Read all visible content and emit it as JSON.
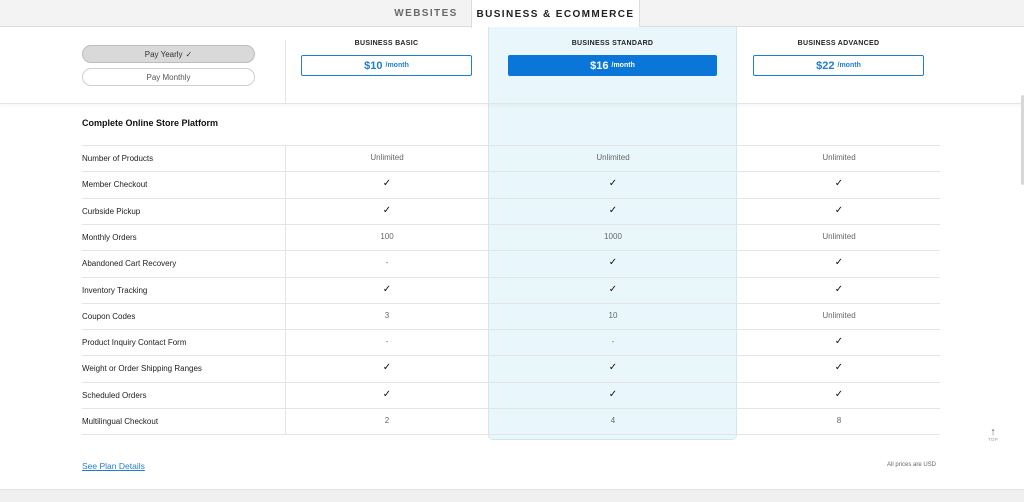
{
  "tabs": [
    {
      "label": "WEBSITES",
      "active": false
    },
    {
      "label": "BUSINESS & ECOMMERCE",
      "active": true
    }
  ],
  "billing": {
    "yearly_label": "Pay Yearly",
    "yearly_check": "✓",
    "monthly_label": "Pay Monthly",
    "selected": "yearly"
  },
  "plans": [
    {
      "name": "BUSINESS BASIC",
      "price": "$10",
      "period": "/month",
      "highlighted": false
    },
    {
      "name": "BUSINESS STANDARD",
      "price": "$16",
      "period": "/month",
      "highlighted": true
    },
    {
      "name": "BUSINESS ADVANCED",
      "price": "$22",
      "period": "/month",
      "highlighted": false
    }
  ],
  "section_title": "Complete Online Store Platform",
  "features": [
    {
      "label": "Number of Products",
      "values": [
        "Unlimited",
        "Unlimited",
        "Unlimited"
      ]
    },
    {
      "label": "Member Checkout",
      "values": [
        "✓",
        "✓",
        "✓"
      ]
    },
    {
      "label": "Curbside Pickup",
      "values": [
        "✓",
        "✓",
        "✓"
      ]
    },
    {
      "label": "Monthly Orders",
      "values": [
        "100",
        "1000",
        "Unlimited"
      ]
    },
    {
      "label": "Abandoned Cart Recovery",
      "values": [
        "-",
        "✓",
        "✓"
      ]
    },
    {
      "label": "Inventory Tracking",
      "values": [
        "✓",
        "✓",
        "✓"
      ]
    },
    {
      "label": "Coupon Codes",
      "values": [
        "3",
        "10",
        "Unlimited"
      ]
    },
    {
      "label": "Product Inquiry Contact Form",
      "values": [
        "-",
        "-",
        "✓"
      ]
    },
    {
      "label": "Weight or Order Shipping Ranges",
      "values": [
        "✓",
        "✓",
        "✓"
      ]
    },
    {
      "label": "Scheduled Orders",
      "values": [
        "✓",
        "✓",
        "✓"
      ]
    },
    {
      "label": "Multilingual Checkout",
      "values": [
        "2",
        "4",
        "8"
      ]
    }
  ],
  "footer": {
    "plan_details_link": "See Plan Details",
    "prices_note": "All prices are USD",
    "top_label": "TOP",
    "top_arrow": "🠕"
  },
  "colors": {
    "accent": "#0a76d8",
    "highlight_bg": "#e9f7fd"
  }
}
